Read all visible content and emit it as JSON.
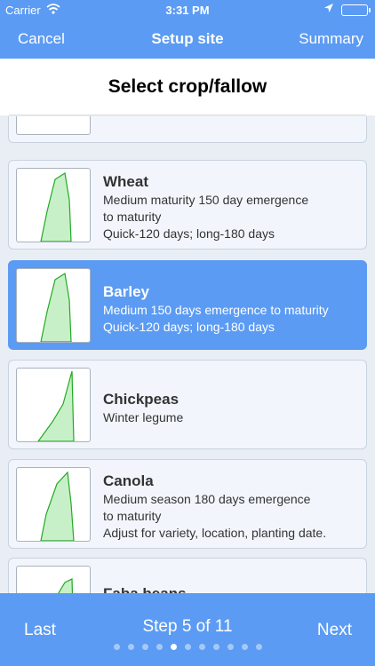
{
  "status": {
    "carrier": "Carrier",
    "time": "3:31 PM"
  },
  "nav": {
    "cancel": "Cancel",
    "title": "Setup site",
    "summary": "Summary"
  },
  "heading": "Select crop/fallow",
  "crops": [
    {
      "name": "",
      "description": ""
    },
    {
      "name": "Wheat",
      "description": "Medium maturity 150 day emergence\nto maturity\nQuick-120 days; long-180 days"
    },
    {
      "name": "Barley",
      "description": "Medium 150 days emergence to maturity\nQuick-120 days; long-180 days"
    },
    {
      "name": "Chickpeas",
      "description": "Winter legume"
    },
    {
      "name": "Canola",
      "description": "Medium season 180 days  emergence\nto maturity\nAdjust for variety, location, planting date."
    },
    {
      "name": "Faba beans",
      "description": ""
    }
  ],
  "footer": {
    "last": "Last",
    "step": "Step 5 of 11",
    "next": "Next",
    "total_dots": 11,
    "current_dot": 5
  },
  "colors": {
    "accent": "#5b9bf3",
    "curve_fill": "#c8f0c8",
    "curve_stroke": "#22aa22"
  }
}
